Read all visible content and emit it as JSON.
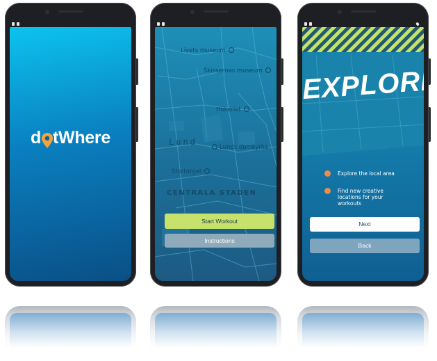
{
  "colors": {
    "splash_top": "#0cc3ee",
    "splash_bottom": "#0a4f86",
    "pin_orange": "#f6a23a",
    "start_button": "#c7e26b",
    "stripe_yellow": "#c7e26b",
    "bullet_orange": "#f28a4a"
  },
  "splash": {
    "logo_prefix": "d",
    "logo_suffix": "tWhere",
    "logo_icon": "map-pin-icon"
  },
  "map_screen": {
    "places": [
      {
        "label": "Livets museum",
        "icon": "location-marker-icon"
      },
      {
        "label": "Skissernas museum",
        "icon": "location-marker-icon"
      },
      {
        "label": "Hökeriet",
        "icon": "location-marker-icon"
      },
      {
        "label": "Lunds domkyrka",
        "icon": "landmark-icon"
      },
      {
        "label": "Stortorget",
        "icon": "location-marker-icon"
      }
    ],
    "city_label": "Lund",
    "district_label": "CENTRALA STADEN",
    "start_label": "Start Workout",
    "instructions_label": "Instructions"
  },
  "explore_screen": {
    "title": "EXPLORE",
    "bullets": [
      "Explore the local area",
      "Find new creative locations for your workouts"
    ],
    "next_label": "Next",
    "back_label": "Back"
  }
}
